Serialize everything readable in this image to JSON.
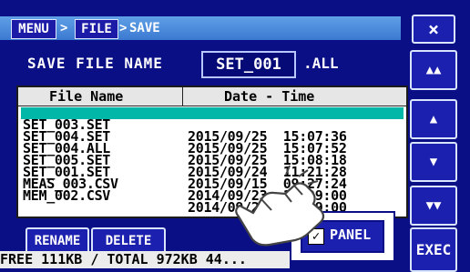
{
  "breadcrumb": {
    "menu": "MENU",
    "file": "FILE",
    "save": "SAVE",
    "sep": ">"
  },
  "close_label": "×",
  "save_name": {
    "label": "SAVE FILE NAME",
    "value": "SET_001",
    "ext": ".ALL"
  },
  "table": {
    "headers": [
      "File Name",
      "Date - Time"
    ],
    "rows": [
      {
        "name": "SET_003.SET",
        "datetime": "2015/09/25  15:07:36",
        "selected": true
      },
      {
        "name": "SET_004.SET",
        "datetime": "2015/09/25  15:07:52"
      },
      {
        "name": "SET_004.ALL",
        "datetime": "2015/09/25  15:08:18"
      },
      {
        "name": "SET_005.SET",
        "datetime": "2015/09/24  11:21:28"
      },
      {
        "name": "SET_001.SET",
        "datetime": "2015/09/15  09:27:24"
      },
      {
        "name": "MEAS_003.CSV",
        "datetime": "2014/09/23  12:09:00"
      },
      {
        "name": "MEM_002.CSV",
        "datetime": "2014/09/23  12:09:00"
      }
    ]
  },
  "buttons": {
    "rename": "RENAME",
    "delete": "DELETE",
    "panel": "PANEL",
    "exec": "EXEC"
  },
  "footer": "FREE 111KB / TOTAL 972KB 44...",
  "icons": {
    "close": "×",
    "top": "▲▲",
    "up": "▲",
    "down": "▼",
    "bottom": "▼▼"
  }
}
